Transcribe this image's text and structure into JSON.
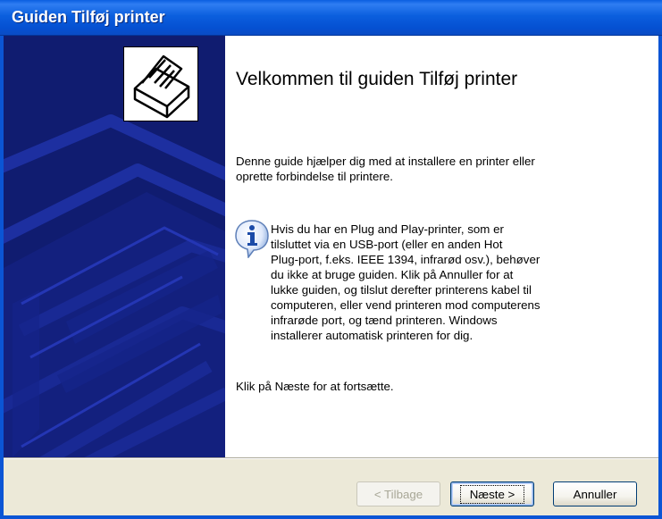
{
  "window": {
    "title": "Guiden Tilføj printer"
  },
  "main": {
    "heading": "Velkommen til guiden Tilføj printer",
    "intro_line1": "Denne guide hjælper dig med at installere en printer eller",
    "intro_line2": "oprette forbindelse til printere.",
    "info_lines": [
      "Hvis du har en Plug and Play-printer, som er",
      "tilsluttet via en USB-port (eller en anden Hot",
      "Plug-port, f.eks. IEEE 1394, infrarød osv.), behøver",
      "du ikke at bruge guiden. Klik på Annuller for at",
      "lukke guiden, og tilslut derefter printerens kabel til",
      "computeren, eller vend printeren mod computerens",
      "infrarøde port, og tænd printeren. Windows",
      "installerer automatisk printeren for dig."
    ],
    "continue": "Klik på Næste for at fortsætte."
  },
  "buttons": {
    "back": "< Tilbage",
    "next": "Næste >",
    "cancel": "Annuller"
  },
  "icons": {
    "side": "printer-icon",
    "info": "info-icon"
  },
  "colors": {
    "titlebar": "#0b5fde",
    "side_panel": "#101c70",
    "dialog_bg": "#ece9d8"
  }
}
